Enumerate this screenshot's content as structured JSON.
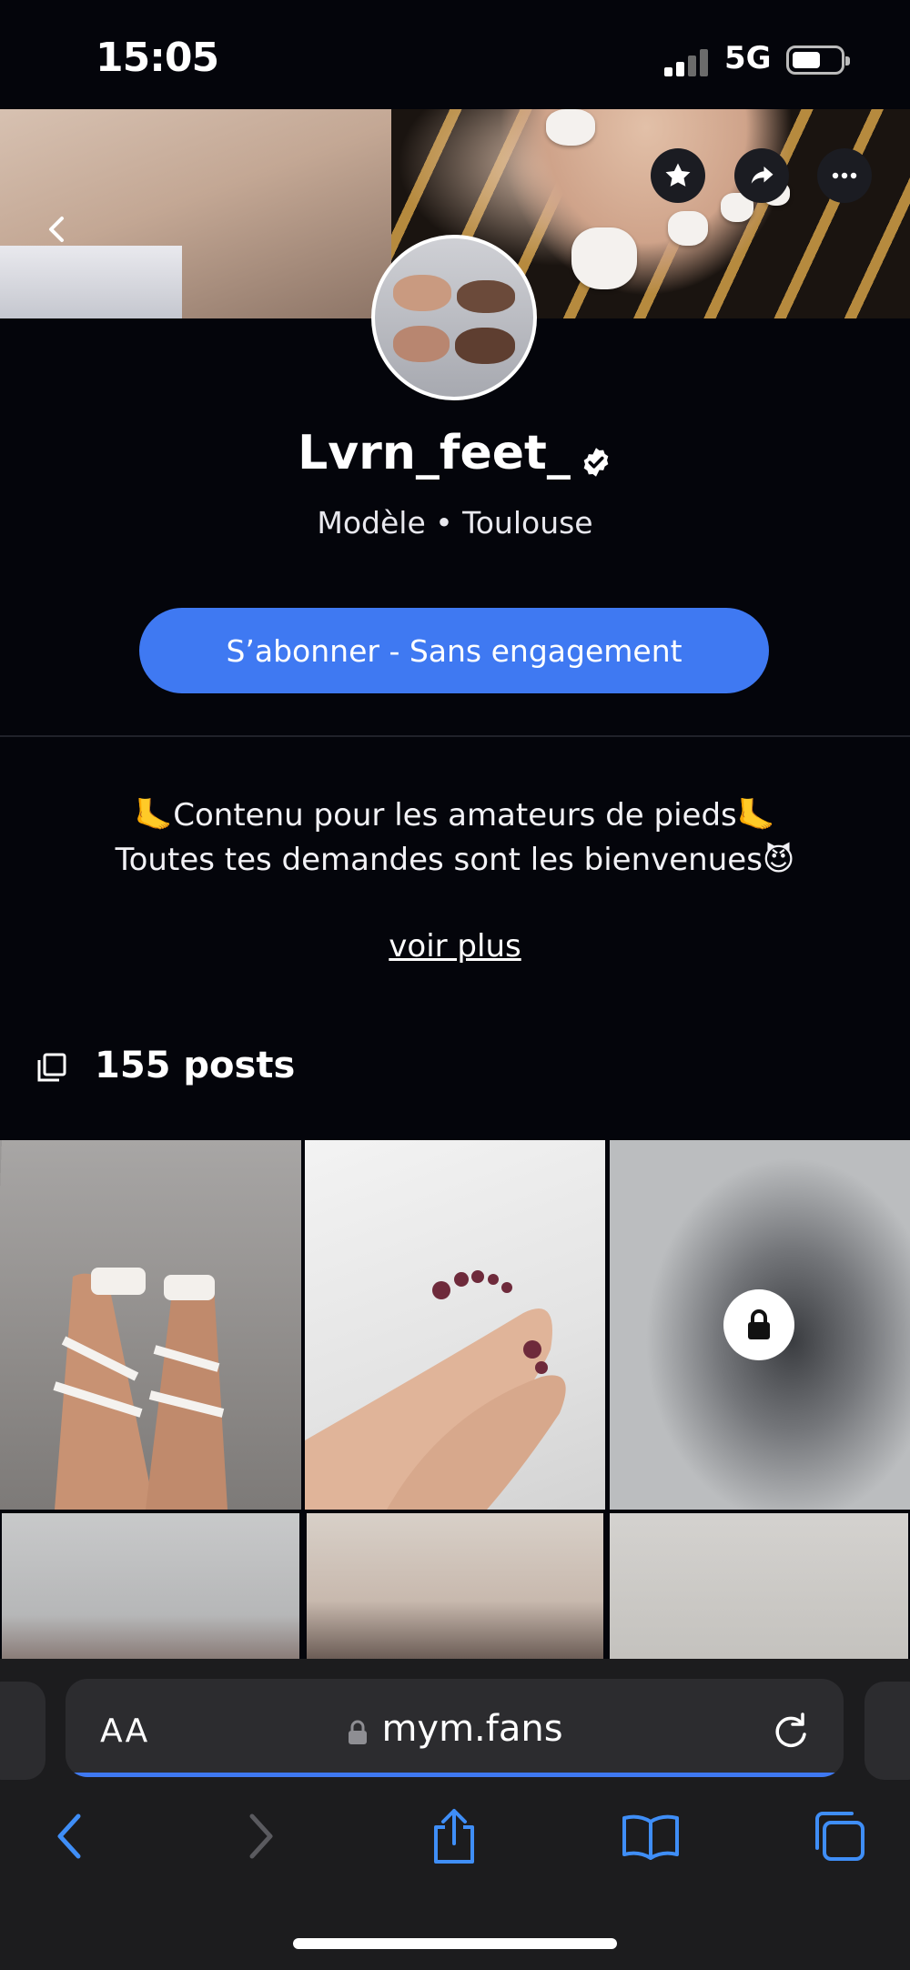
{
  "status_bar": {
    "time": "15:05",
    "network": "5G",
    "signal_bars": 2,
    "battery_level": 0.5
  },
  "profile": {
    "name": "Lvrn_feet_",
    "verified": true,
    "subtitle": "Modèle • Toulouse",
    "subscribe_label": "S’abonner - Sans engagement",
    "bio_line1": "🦶Contenu pour les amateurs de pieds🦶",
    "bio_line2": "Toutes tes demandes sont les bienvenues😈",
    "see_more": "voir plus",
    "posts_count": "155 posts"
  },
  "header_actions": [
    "star-icon",
    "share-icon",
    "more-icon"
  ],
  "grid": {
    "tiles": [
      {
        "locked": false,
        "blurred": false
      },
      {
        "locked": false,
        "blurred": false
      },
      {
        "locked": true,
        "blurred": true
      },
      {
        "locked": false,
        "blurred": true
      },
      {
        "locked": false,
        "blurred": true
      },
      {
        "locked": false,
        "blurred": true
      }
    ]
  },
  "browser": {
    "text_size_label": "AA",
    "url": "mym.fans",
    "load_progress": 1.0
  },
  "colors": {
    "accent": "#3f79f2",
    "background": "#04050b",
    "toolbar": "#1c1c1e"
  }
}
